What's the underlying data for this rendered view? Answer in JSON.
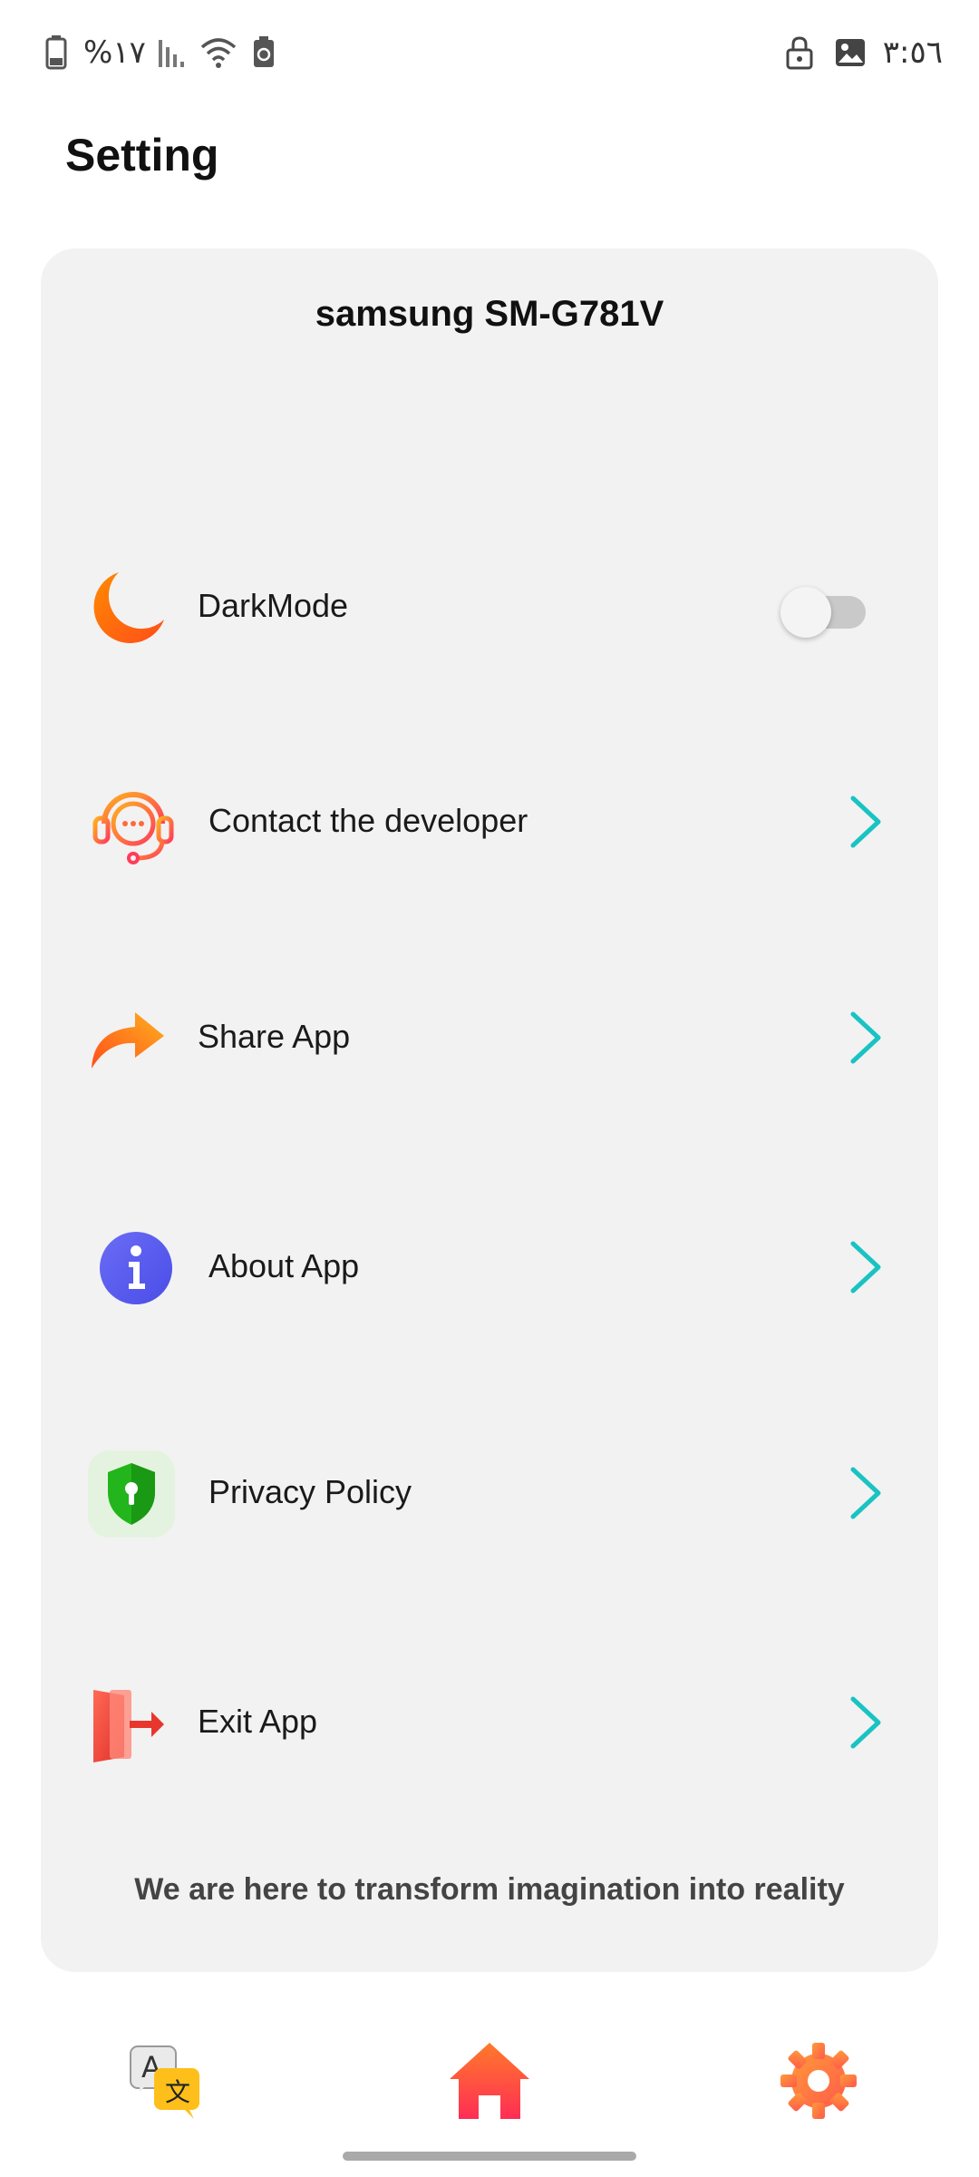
{
  "status_bar": {
    "battery_text": "%١٧",
    "time": "٣:٥٦"
  },
  "header": {
    "title": "Setting"
  },
  "card": {
    "device_name": "samsung SM-G781V",
    "items": [
      {
        "label": "DarkMode",
        "icon": "moon-icon",
        "control": "toggle",
        "toggle_on": false
      },
      {
        "label": "Contact the developer",
        "icon": "headset-chat-icon",
        "control": "chevron"
      },
      {
        "label": "Share App",
        "icon": "share-arrow-icon",
        "control": "chevron"
      },
      {
        "label": "About App",
        "icon": "info-icon",
        "control": "chevron"
      },
      {
        "label": "Privacy Policy",
        "icon": "shield-lock-icon",
        "control": "chevron"
      },
      {
        "label": "Exit App",
        "icon": "exit-door-icon",
        "control": "chevron"
      }
    ],
    "tagline": "We are here to transform imagination into reality"
  },
  "bottom_nav": {
    "items": [
      {
        "icon": "translate-icon"
      },
      {
        "icon": "home-icon"
      },
      {
        "icon": "gear-icon"
      }
    ]
  },
  "colors": {
    "accent_orange": "#ff6a13",
    "chevron_teal": "#19c3c3",
    "info_purple": "#5b5ef0",
    "shield_green": "#22b318",
    "exit_red": "#f0443a",
    "home_pink": "#ff2d55"
  }
}
